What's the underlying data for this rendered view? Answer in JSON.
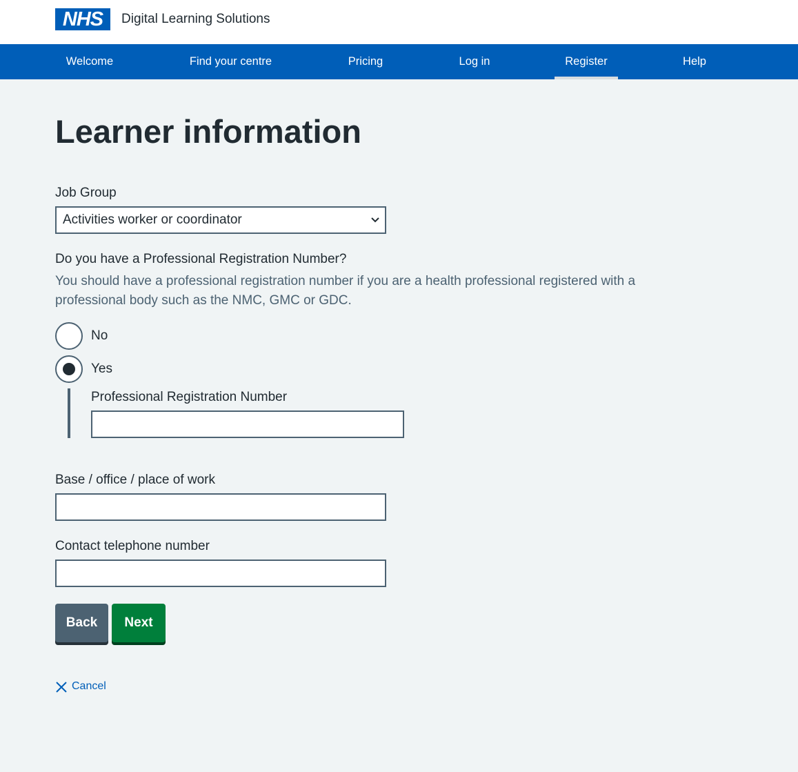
{
  "header": {
    "logo_text": "NHS",
    "service_name": "Digital Learning Solutions"
  },
  "nav": {
    "items": [
      {
        "label": "Welcome",
        "active": false
      },
      {
        "label": "Find your centre",
        "active": false
      },
      {
        "label": "Pricing",
        "active": false
      },
      {
        "label": "Log in",
        "active": false
      },
      {
        "label": "Register",
        "active": true
      },
      {
        "label": "Help",
        "active": false
      }
    ]
  },
  "page": {
    "title": "Learner information"
  },
  "form": {
    "job_group": {
      "label": "Job Group",
      "selected": "Activities worker or coordinator"
    },
    "prn_question": {
      "label": "Do you have a Professional Registration Number?",
      "hint": "You should have a professional registration number if you are a health professional registered with a professional body such as the NMC, GMC or GDC.",
      "options": [
        {
          "label": "No",
          "checked": false
        },
        {
          "label": "Yes",
          "checked": true
        }
      ]
    },
    "prn_field": {
      "label": "Professional Registration Number",
      "value": ""
    },
    "workplace": {
      "label": "Base / office / place of work",
      "value": ""
    },
    "telephone": {
      "label": "Contact telephone number",
      "value": ""
    },
    "back_label": "Back",
    "next_label": "Next",
    "cancel_label": "Cancel"
  },
  "colors": {
    "brand_blue": "#005eb8",
    "page_background": "#f0f4f5",
    "back_button": "#4c6272",
    "next_button": "#007f3b"
  }
}
